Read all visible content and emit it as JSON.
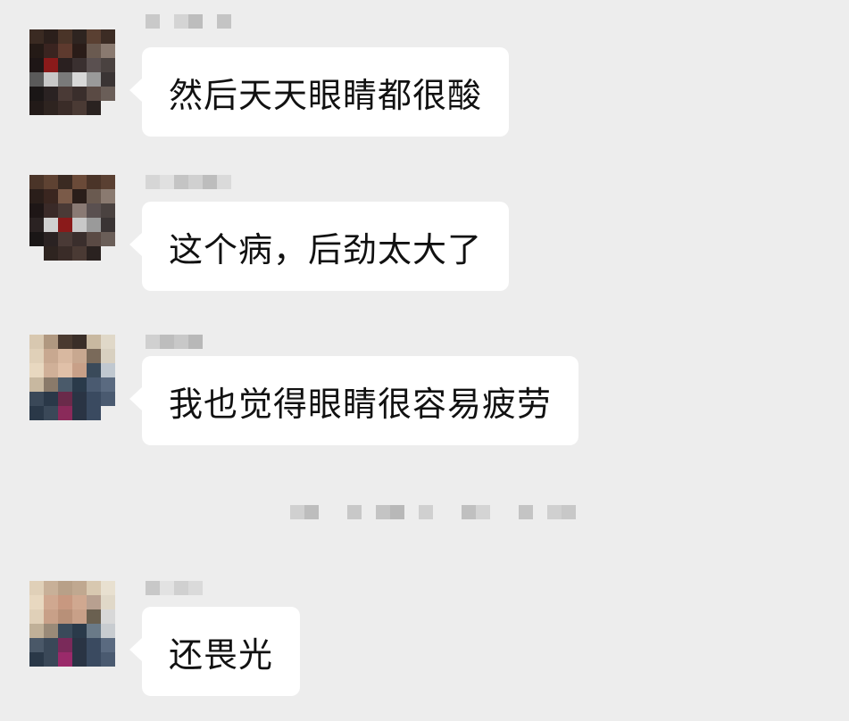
{
  "messages": [
    {
      "text": "然后天天眼睛都很酸",
      "avatar": "blurred-avatar-dark"
    },
    {
      "text": "这个病，后劲太大了",
      "avatar": "blurred-avatar-dark"
    },
    {
      "text": "我也觉得眼睛很容易疲劳",
      "avatar": "blurred-avatar-light"
    },
    {
      "text": "还畏光",
      "avatar": "blurred-avatar-light"
    }
  ],
  "colors": {
    "background": "#ededed",
    "bubble": "#ffffff",
    "text": "#111111"
  }
}
